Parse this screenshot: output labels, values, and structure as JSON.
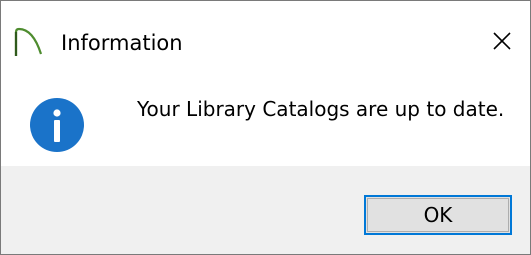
{
  "window": {
    "title": "Information",
    "app_icon": "arch-logo-icon",
    "close_icon": "close-icon"
  },
  "content": {
    "icon": "info-icon",
    "message": "Your Library Catalogs are up to date."
  },
  "footer": {
    "ok_label": "OK"
  },
  "colors": {
    "info_blue": "#1a73c9",
    "button_focus_border": "#0078d7",
    "footer_bg": "#f0f0f0",
    "app_icon_green": "#4e8c2f"
  }
}
